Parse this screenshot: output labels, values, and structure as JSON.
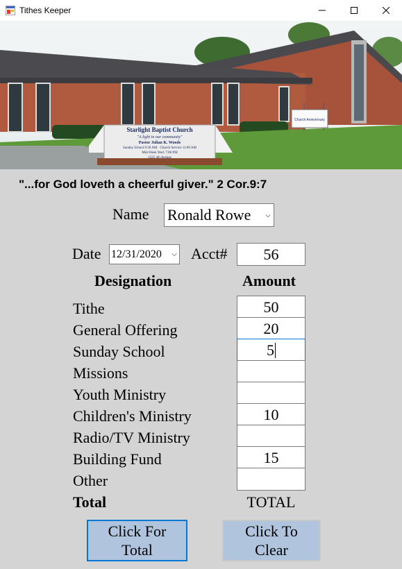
{
  "window": {
    "title": "Tithes Keeper"
  },
  "photo": {
    "sign_name": "Starlight Baptist Church",
    "sign_tagline": "\"A light in our community\"",
    "sign_pastor": "Pastor Julian K. Woods",
    "sign_line1": "Sunday School 9:30 AM · Church Service 11:00 AM",
    "sign_line2": "Mid-Week Wed. 7:00 PM",
    "sign_address": "1525 4th Avenue",
    "banner_text": "Church Anniversary"
  },
  "verse": "\"...for God loveth a cheerful giver.\" 2 Cor.9:7",
  "form": {
    "name_label": "Name",
    "name_value": "Ronald Rowe",
    "date_label": "Date",
    "date_value": "12/31/2020",
    "acct_label": "Acct#",
    "acct_value": "56",
    "designation_header": "Designation",
    "amount_header": "Amount",
    "rows": [
      {
        "label": "Tithe",
        "amount": "50"
      },
      {
        "label": "General Offering",
        "amount": "20"
      },
      {
        "label": "Sunday School",
        "amount": "5"
      },
      {
        "label": "Missions",
        "amount": ""
      },
      {
        "label": "Youth Ministry",
        "amount": ""
      },
      {
        "label": "Children's Ministry",
        "amount": "10"
      },
      {
        "label": "Radio/TV Ministry",
        "amount": ""
      },
      {
        "label": "Building Fund",
        "amount": "15"
      },
      {
        "label": "Other",
        "amount": ""
      }
    ],
    "total_label": "Total",
    "total_value": "TOTAL"
  },
  "buttons": {
    "total_line1": "Click For",
    "total_line2": "Total",
    "clear_line1": "Click To",
    "clear_line2": "Clear"
  }
}
